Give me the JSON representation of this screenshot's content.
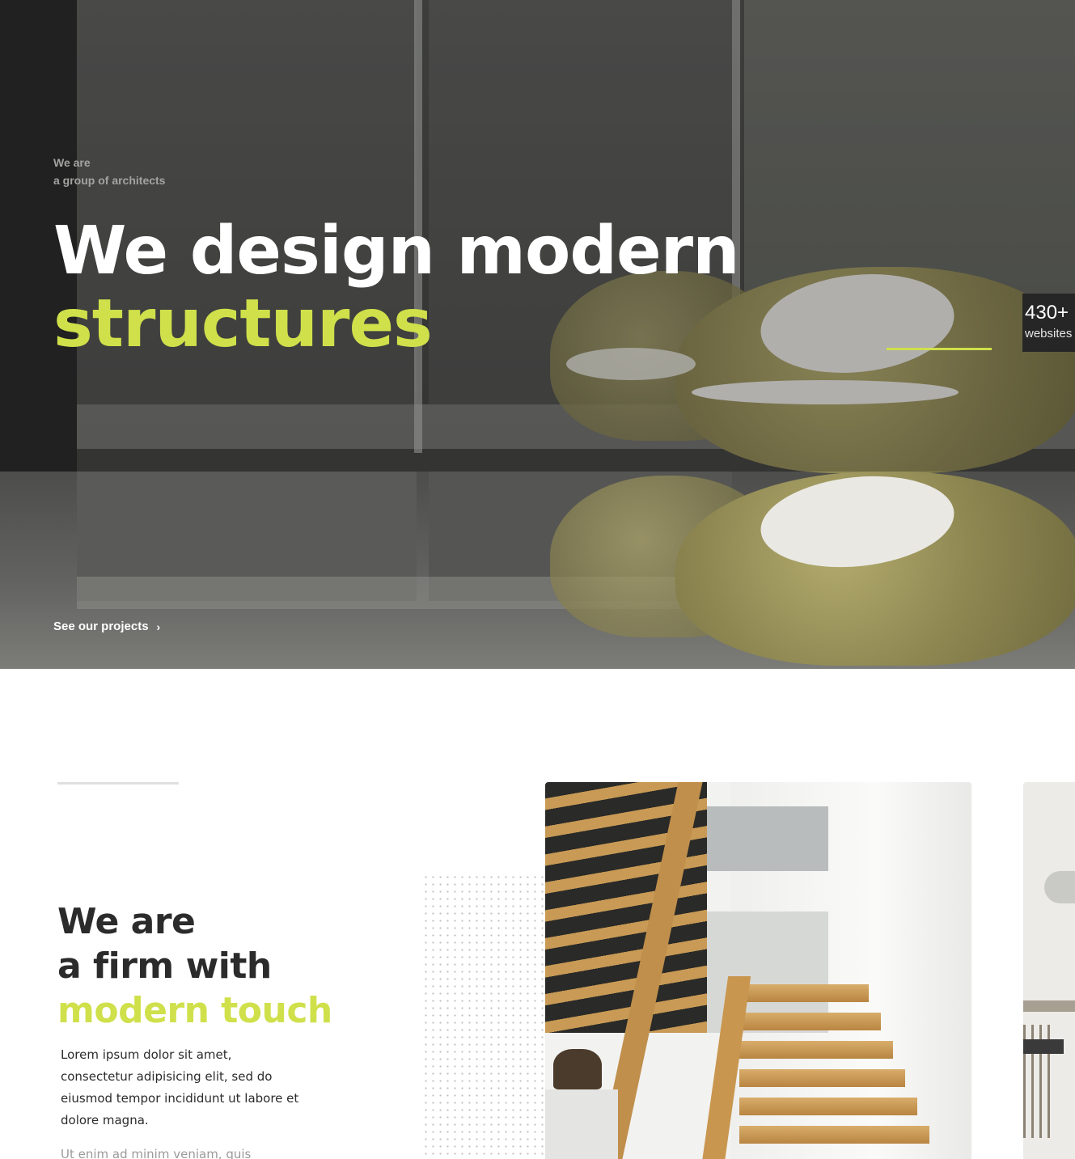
{
  "hero": {
    "eyebrow_line1": "We are",
    "eyebrow_line2": "a group of architects",
    "title_line1": "We design modern",
    "title_accent": "structures",
    "cta_label": "See our projects",
    "cta_icon": "chevron-right-icon",
    "stat_value": "430+",
    "stat_label": "websites"
  },
  "about": {
    "title_line1": "We are",
    "title_line2": "a firm with",
    "title_accent": "modern touch",
    "body": "Lorem ipsum dolor sit amet, consectetur adipisicing elit, sed do eiusmod tempor incididunt ut labore et dolore magna.",
    "body_secondary": "Ut enim ad minim veniam, quis"
  },
  "colors": {
    "accent": "#cfe04b",
    "dark_text": "#2b2b2b",
    "muted_text": "#9a9a9a"
  }
}
